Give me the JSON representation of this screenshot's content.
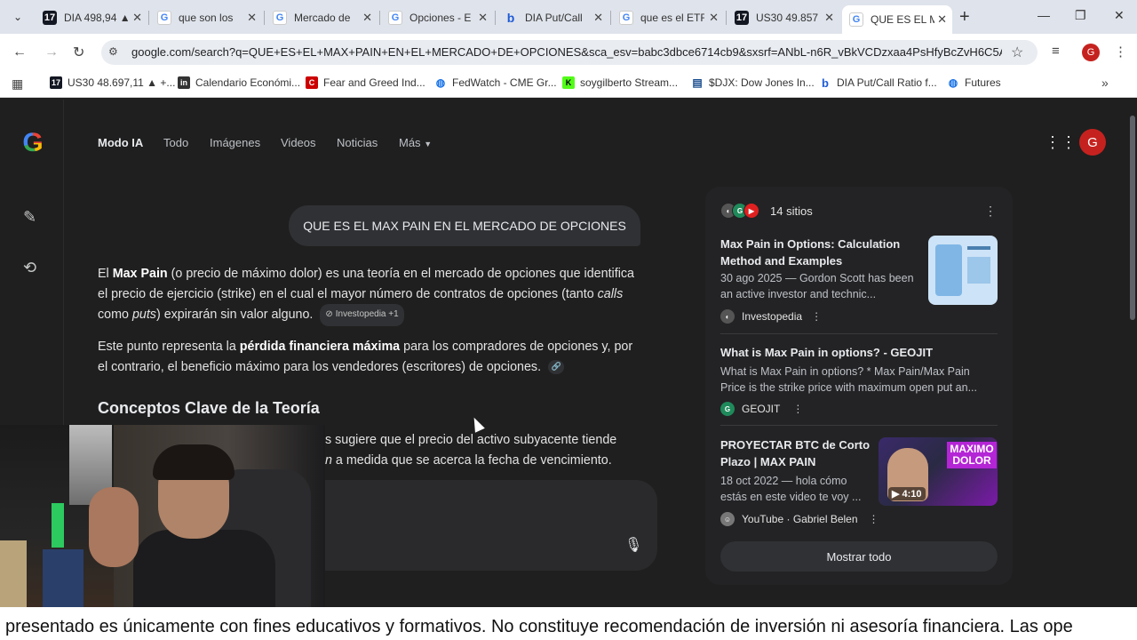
{
  "tabs": [
    {
      "title": "DIA 498,94 ▲",
      "icon": "tradingview-icon"
    },
    {
      "title": "que son los",
      "icon": "google-icon"
    },
    {
      "title": "Mercado de",
      "icon": "google-icon"
    },
    {
      "title": "Opciones - E",
      "icon": "google-icon"
    },
    {
      "title": "DIA Put/Call",
      "icon": "bing-icon"
    },
    {
      "title": "que es el ETF",
      "icon": "google-icon"
    },
    {
      "title": "US30 49.857",
      "icon": "tradingview-icon"
    },
    {
      "title": "QUE ES EL M",
      "icon": "google-icon",
      "active": true
    }
  ],
  "toolbar": {
    "url": "google.com/search?q=QUE+ES+EL+MAX+PAIN+EN+EL+MERCADO+DE+OPCIONES&sca_esv=babc3dbce6714cb9&sxsrf=ANbL-n6R_vBkVCDzxaa4PsHfyBcZvH6C5A%...",
    "profile_initial": "G"
  },
  "bookmarks": [
    {
      "label": "US30 48.697,11 ▲ +...",
      "icon": "tradingview-icon"
    },
    {
      "label": "Calendario Económi...",
      "icon": "investing-icon"
    },
    {
      "label": "Fear and Greed Ind...",
      "icon": "cnn-icon"
    },
    {
      "label": "FedWatch - CME Gr...",
      "icon": "globe-icon"
    },
    {
      "label": "soygilberto Stream...",
      "icon": "kick-icon"
    },
    {
      "label": "$DJX: Dow Jones In...",
      "icon": "barchart-icon"
    },
    {
      "label": "DIA Put/Call Ratio f...",
      "icon": "bing-icon"
    },
    {
      "label": "Futures",
      "icon": "globe-icon"
    }
  ],
  "google": {
    "nav": [
      "Modo IA",
      "Todo",
      "Imágenes",
      "Videos",
      "Noticias",
      "Más"
    ],
    "avatar_initial": "G"
  },
  "ai": {
    "query": "QUE ES EL MAX PAIN EN EL MERCADO DE OPCIONES",
    "p1_a": "El ",
    "p1_b": "Max Pain",
    "p1_c": " (o precio de máximo dolor) es una teoría en el mercado de opciones que identifica el precio de ejercicio (strike) en el cual el mayor número de contratos de opciones (tanto ",
    "p1_d": "calls",
    "p1_e": " como ",
    "p1_f": "puts",
    "p1_g": ") expirarán sin valor alguno.",
    "p1_chip": "Investopedia +1",
    "p2_a": "Este punto representa la ",
    "p2_b": "pérdida financiera máxima",
    "p2_c": " para los compradores de opciones y, por el contrario, el beneficio máximo para los vendedores (escritores) de opciones.",
    "heading": "Conceptos Clave de la Teoría",
    "partial_1": "s sugiere que el precio del activo subyacente tiende",
    "partial_2_i": "n",
    "partial_2": " a medida que se acerca la fecha de vencimiento."
  },
  "sources": {
    "count_label": "14 sitios",
    "items": [
      {
        "title": "Max Pain in Options: Calculation Method and Examples",
        "snippet": "30 ago 2025 — Gordon Scott has been an active investor and technic...",
        "site": "Investopedia"
      },
      {
        "title": "What is Max Pain in options? - GEOJIT",
        "snippet": "What is Max Pain in options? * Max Pain/Max Pain Price is the strike price with maximum open put an...",
        "site": "GEOJIT"
      },
      {
        "title": "PROYECTAR BTC de Corto Plazo | MAX PAIN",
        "snippet": "18 oct 2022 — hola cómo estás en este video te voy ...",
        "site": "YouTube · Gabriel Belen",
        "duration": "4:10",
        "thumb_text": "MAXIMO DOLOR"
      }
    ],
    "show_all": "Mostrar todo"
  },
  "caption": "presentado es únicamente con fines educativos y formativos. No constituye recomendación de inversión ni asesoría financiera. Las ope"
}
